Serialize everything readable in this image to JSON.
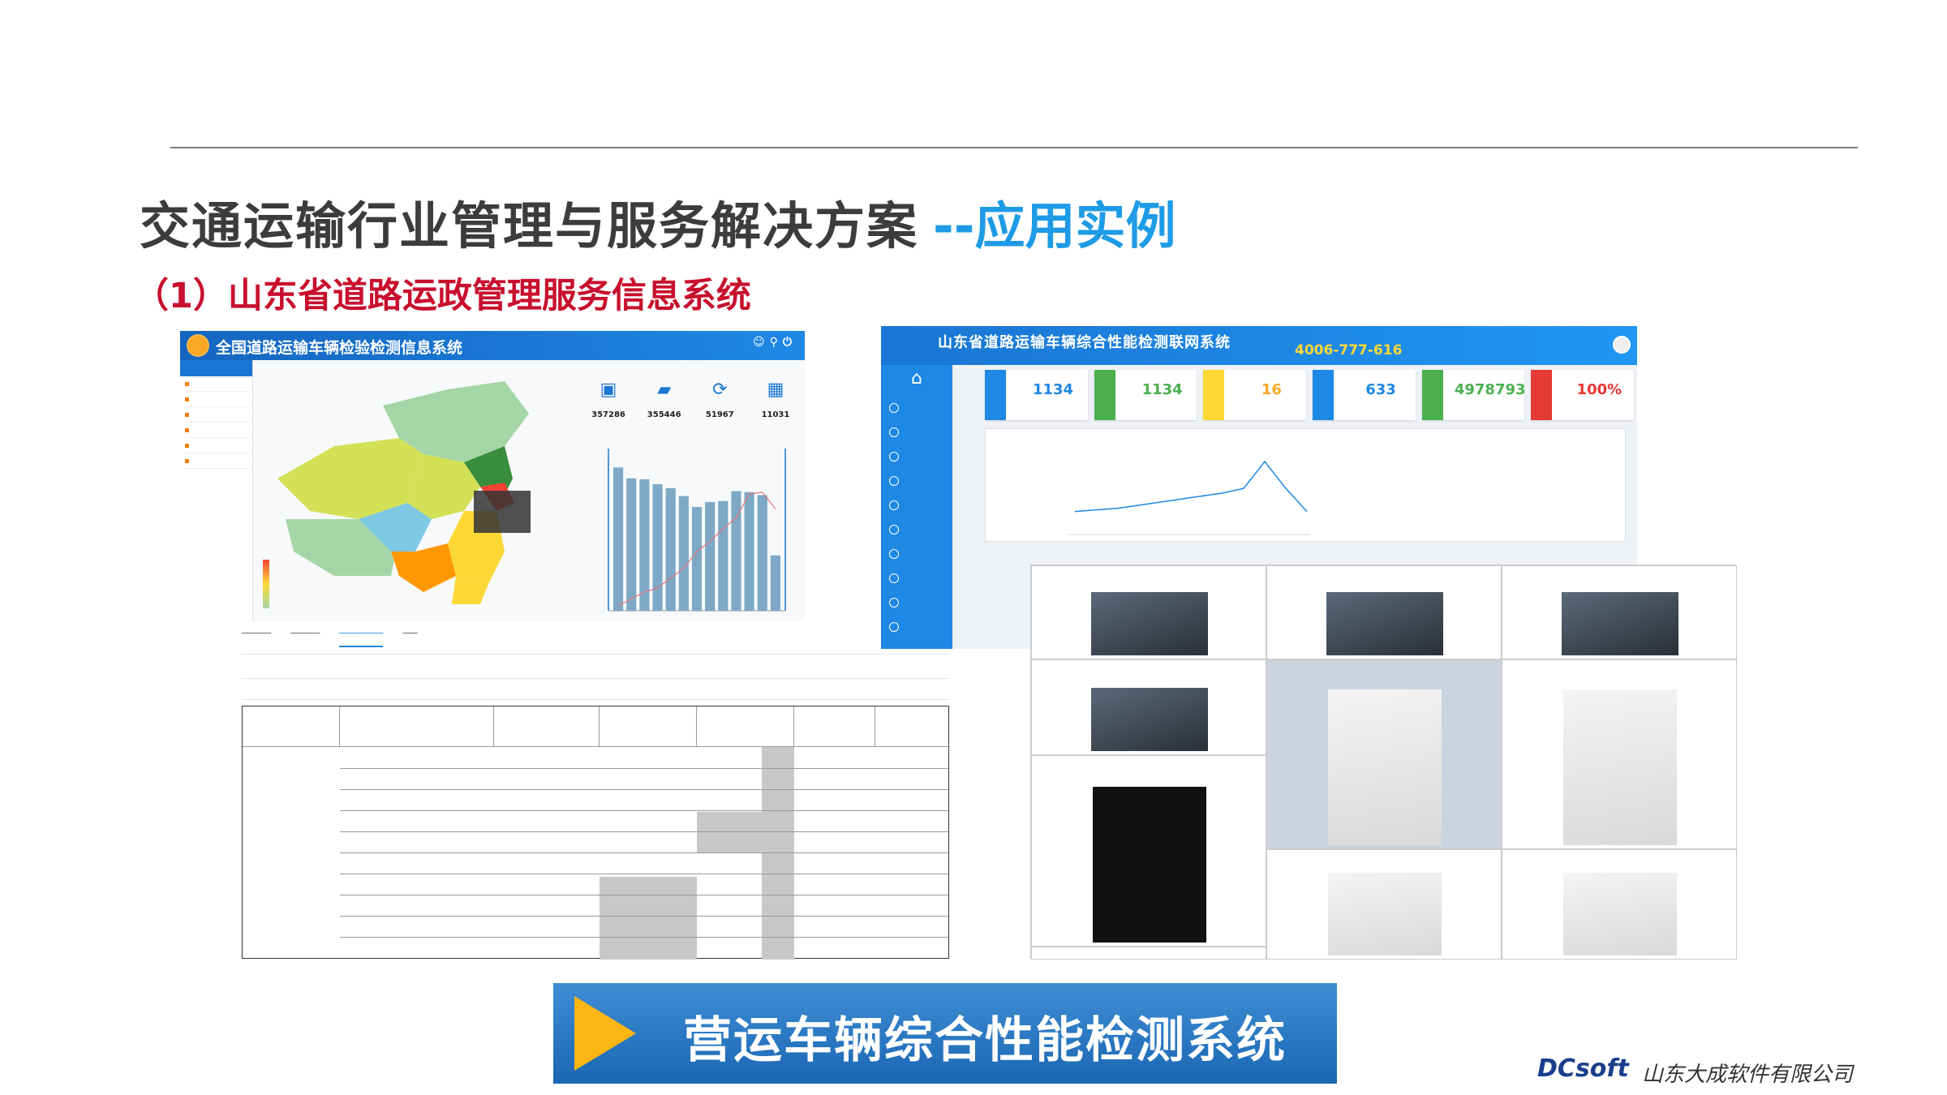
{
  "slide": {
    "title": "交通运输行业管理与服务解决方案",
    "subtitle": "--应用实例",
    "section": "（1）山东省道路运政管理服务信息系统",
    "banner": "营运车辆综合性能检测系统",
    "brand_logo": "DCsoft",
    "brand_name": "山东大成软件有限公司"
  },
  "left_app": {
    "title": "全国道路运输车辆检验检测信息系统",
    "stats": [
      {
        "icon": "car-front-icon",
        "value": "357286"
      },
      {
        "icon": "car-icon",
        "value": "355446"
      },
      {
        "icon": "refresh-car-icon",
        "value": "51967"
      },
      {
        "icon": "building-icon",
        "value": "11031"
      }
    ],
    "chart_data": {
      "type": "bar",
      "values": [
        1450,
        1340,
        1330,
        1280,
        1240,
        1160,
        1050,
        1100,
        1110,
        1210,
        1200,
        1170,
        560
      ],
      "line": [
        50,
        120,
        190,
        230,
        330,
        430,
        600,
        700,
        830,
        940,
        1180,
        1200,
        1030
      ],
      "ylim": [
        0,
        1600
      ],
      "colors": {
        "bar": "#7ea9c6",
        "line": "#e57373"
      }
    },
    "map_colors": [
      "#7ec8e3",
      "#a5d6a7",
      "#d4e157",
      "#fdd835",
      "#ff9800",
      "#f44336",
      "#388e3c"
    ]
  },
  "detection_table": {
    "gray_cols": true
  },
  "right_app": {
    "title": "山东省道路运输车辆综合性能检测联网系统",
    "hotline": "4006-777-616",
    "cards": [
      {
        "value": "1134",
        "color": "#1e88e5"
      },
      {
        "value": "1134",
        "color": "#4caf50"
      },
      {
        "value": "16",
        "color": "#fdd835"
      },
      {
        "value": "633",
        "color": "#1e88e5"
      },
      {
        "value": "4978793",
        "color": "#4caf50"
      },
      {
        "value": "100%",
        "color": "#e53935"
      }
    ],
    "sparkline": [
      30,
      32,
      34,
      38,
      42,
      46,
      50,
      54,
      60,
      95,
      60,
      30
    ],
    "home_icon": "home-icon"
  }
}
